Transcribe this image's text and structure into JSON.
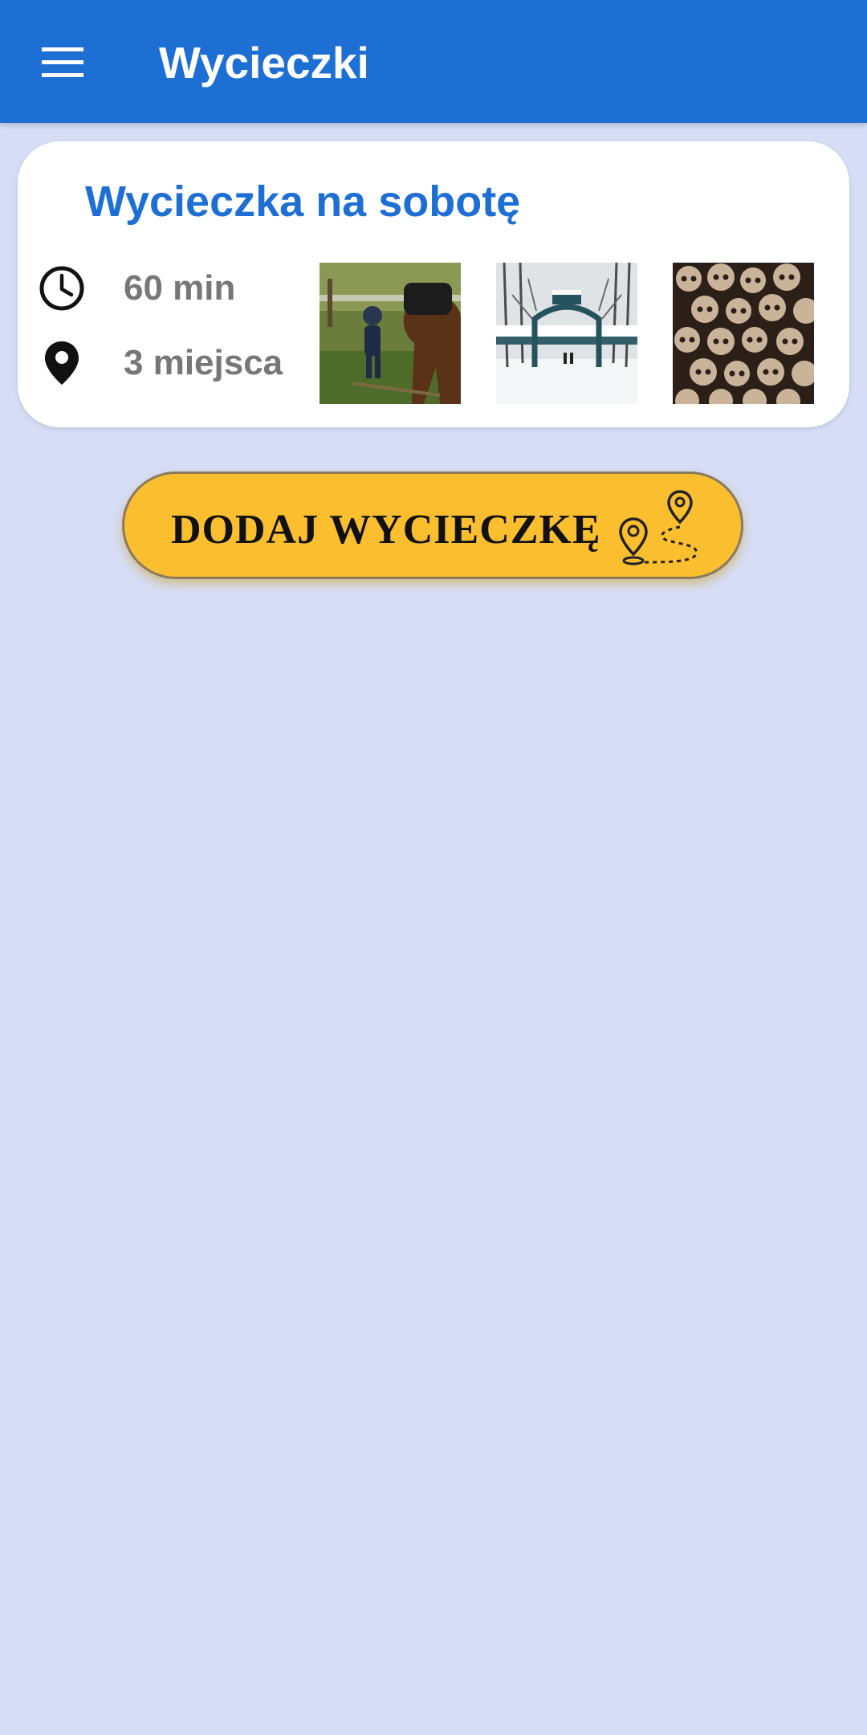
{
  "app_bar": {
    "title": "Wycieczki",
    "menu_icon": "hamburger-menu-icon"
  },
  "trip_card": {
    "title": "Wycieczka na sobotę",
    "duration": "60 min",
    "duration_icon": "clock-icon",
    "places": "3 miejsca",
    "places_icon": "location-pin-icon",
    "thumbnails": [
      {
        "subject": "child leading a horse"
      },
      {
        "subject": "snowy park gate"
      },
      {
        "subject": "wall of skulls"
      }
    ]
  },
  "add_trip_button": {
    "label": "DODAJ WYCIECZKĘ",
    "icon": "route-map-pins-icon"
  },
  "colors": {
    "app_bar": "#1e6fd4",
    "background": "#d6ddf5",
    "card": "#ffffff",
    "title": "#1e6fd4",
    "meta_text": "#777777",
    "button": "#fbbe2e"
  }
}
